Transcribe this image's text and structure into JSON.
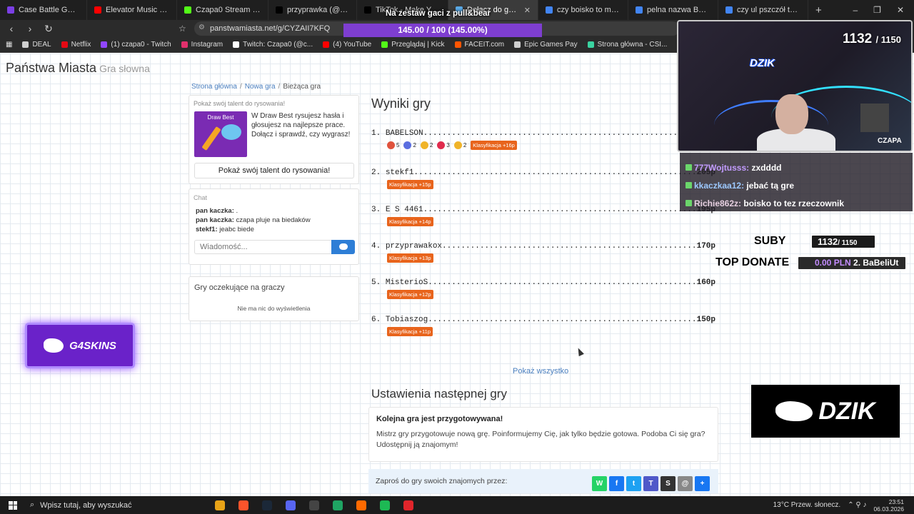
{
  "browser": {
    "tabs": [
      {
        "label": "Case Battle G4Skins | Zdob",
        "color": "#7b3fe4",
        "active": false
      },
      {
        "label": "Elevator Music - YouTube",
        "color": "#ff0000",
        "active": false
      },
      {
        "label": "Czapa0 Stream - Watc",
        "color": "#53fc18",
        "active": false
      },
      {
        "label": "przyprawka (@przyprawka",
        "color": "#000000",
        "active": false
      },
      {
        "label": "TikTok - Make Your Day",
        "color": "#000000",
        "active": false
      },
      {
        "label": "Dołącz do gry Państw",
        "color": "#5aa9e6",
        "active": true
      },
      {
        "label": "czy boisko to miejsce ze",
        "color": "#4285f4",
        "active": false
      },
      {
        "label": "pelna nazwa BMW - Szuk",
        "color": "#4285f4",
        "active": false
      },
      {
        "label": "czy ul pszczół to rzecz - Sz",
        "color": "#4285f4",
        "active": false
      }
    ],
    "url": "panstwamiasta.net/g/CYZAII7KFQ",
    "bookmarks": [
      {
        "label": "DEAL",
        "color": "#cfcfcf"
      },
      {
        "label": "Netflix",
        "color": "#e50914"
      },
      {
        "label": "(1) czapa0 - Twitch",
        "color": "#9146ff"
      },
      {
        "label": "Instagram",
        "color": "#e1306c"
      },
      {
        "label": "Twitch: Czapa0 (@c...",
        "color": "#ffffff"
      },
      {
        "label": "(4) YouTube",
        "color": "#ff0000"
      },
      {
        "label": "Przeglądaj | Kick",
        "color": "#53fc18"
      },
      {
        "label": "FACEIT.com",
        "color": "#ff5500"
      },
      {
        "label": "Epic Games Pay",
        "color": "#cfcfcf"
      },
      {
        "label": "Strona główna - CSI...",
        "color": "#3ad3a0"
      },
      {
        "label": "NUBI",
        "color": "#2b2b2b"
      },
      {
        "label": "STRONY",
        "color": "#cfcfcf"
      },
      {
        "label": "Skrzynki CSx",
        "color": "#9146ff"
      }
    ]
  },
  "site": {
    "name": "Państwa Miasta",
    "subtitle": "Gra słowna",
    "breadcrumb": [
      "Strona główna",
      "Nowa gra",
      "Bieżąca gra"
    ]
  },
  "draw_promo": {
    "title": "Pokaż swój talent do rysowania!",
    "image_label": "Draw Best",
    "description": "W Draw Best rysujesz hasła i głosujesz na najlepsze prace. Dołącz i sprawdź, czy wygrasz!",
    "button": "Pokaż swój talent do rysowania!"
  },
  "chat": {
    "title": "Chat",
    "messages": [
      {
        "user": "pan kaczka:",
        "text": "."
      },
      {
        "user": "pan kaczka:",
        "text": "czapa pluje na biedaków"
      },
      {
        "user": "stekf1:",
        "text": "jeabc biede"
      }
    ],
    "placeholder": "Wiadomość..."
  },
  "waiting": {
    "title": "Gry oczekujące na graczy",
    "empty": "Nie ma nic do wyświetlenia"
  },
  "results": {
    "title": "Wyniki gry",
    "rows": [
      {
        "rank": "1.",
        "name": "BABELSON",
        "points": "",
        "badge": "Klasyfikacja +16p",
        "reactions": [
          {
            "count": "5",
            "color": "#e0533d"
          },
          {
            "count": "2",
            "color": "#5a6ee0"
          },
          {
            "count": "2",
            "color": "#f0b429"
          },
          {
            "count": "3",
            "color": "#e02c4d"
          },
          {
            "count": "2",
            "color": "#f0b429"
          }
        ]
      },
      {
        "rank": "2.",
        "name": "stekf1",
        "points": "205p",
        "badge": "Klasyfikacja +15p"
      },
      {
        "rank": "3.",
        "name": "E S 4461",
        "points": "195p",
        "badge": "Klasyfikacja +14p"
      },
      {
        "rank": "4.",
        "name": "przyprawakox",
        "points": "170p",
        "badge": "Klasyfikacja +13p"
      },
      {
        "rank": "5.",
        "name": "MisterioS",
        "points": "160p",
        "badge": "Klasyfikacja +12p"
      },
      {
        "rank": "6.",
        "name": "Tobiaszog",
        "points": "150p",
        "badge": "Klasyfikacja +11p"
      }
    ],
    "show_all": "Pokaż wszystko"
  },
  "next_game": {
    "title": "Ustawienia następnej gry",
    "heading": "Kolejna gra jest przygotowywana!",
    "text": "Mistrz gry przygotowuje nową grę. Poinformujemy Cię, jak tylko będzie gotowa. Podoba Ci się gra? Udostępnij ją znajomym!",
    "invite": "Zaproś do gry swoich znajomych przez:",
    "share": [
      {
        "name": "whatsapp",
        "glyph": "W",
        "color": "#25d366"
      },
      {
        "name": "facebook",
        "glyph": "f",
        "color": "#1877f2"
      },
      {
        "name": "twitter",
        "glyph": "t",
        "color": "#1da1f2"
      },
      {
        "name": "teams",
        "glyph": "T",
        "color": "#5059c9"
      },
      {
        "name": "snapchat",
        "glyph": "S",
        "color": "#333333"
      },
      {
        "name": "email",
        "glyph": "@",
        "color": "#888888"
      },
      {
        "name": "share",
        "glyph": "+",
        "color": "#1877f2"
      }
    ]
  },
  "overlay": {
    "banner": "Na zestaw gaci z pull&bear",
    "goal": "145.00 / 100 (145.00%)",
    "cam_count": "1132",
    "cam_goal": "/ 1150",
    "cam_brand": "DZIK",
    "cam_name": "CZAPA",
    "g4skins": "G4SKINS",
    "twitch_chat": [
      {
        "user": "777Wojtusss:",
        "text": "zxdddd",
        "cls": "u1"
      },
      {
        "user": "kkaczkaa12:",
        "text": "jebać tą gre",
        "cls": "u2"
      },
      {
        "user": "Richie862z:",
        "text": "boisko to tez rzeczownik",
        "cls": "u3"
      }
    ],
    "suby_label": "SUBY",
    "suby_count": "1132",
    "suby_goal": "/ 1150",
    "top_donate_label": "TOP DONATE",
    "top_donate_amount": "0.00 PLN",
    "top_donate_name": "2. BaBeliUt",
    "dzik_logo": "DZIK"
  },
  "taskbar": {
    "search": "Wpisz tutaj, aby wyszukać",
    "apps": [
      "#e8a317",
      "#fb542b",
      "#1b2838",
      "#5865f2",
      "#444444",
      "#1fa463",
      "#ff6a00",
      "#1db954",
      "#e0252b"
    ],
    "weather": "13°C  Przew. słonecz.",
    "time": "23:51",
    "date": "06.03.2026"
  }
}
